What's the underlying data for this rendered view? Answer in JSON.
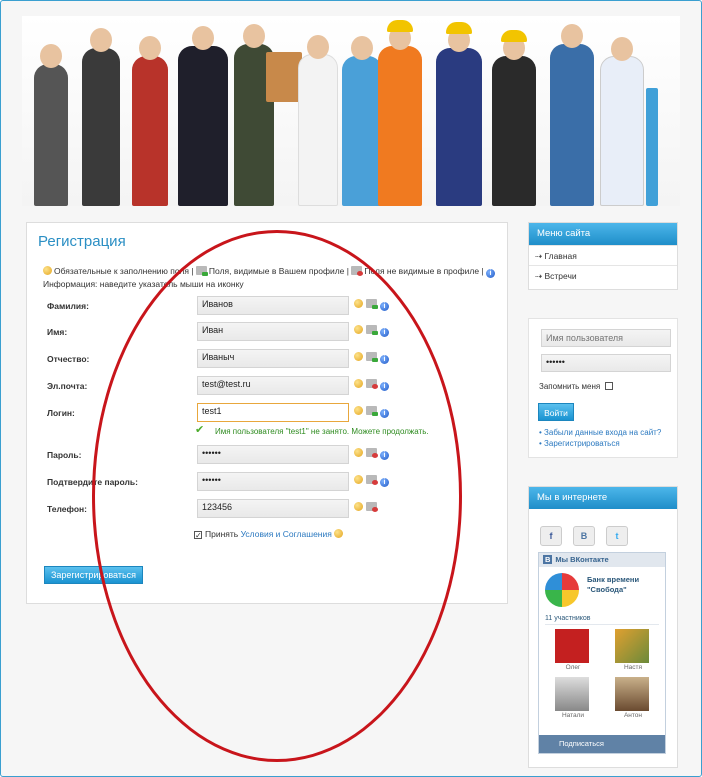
{
  "page": {
    "title": "Регистрация"
  },
  "legend": {
    "required": "Обязательные к заполнению поля |",
    "visible": "Поля, видимые в Вашем профиле |",
    "hidden": "Поля не видимые в профиле |",
    "info": "Информация: наведите указатель мыши на иконку"
  },
  "form": {
    "fields": [
      {
        "label": "Фамилия:",
        "value": "Иванов",
        "icons": [
          "required-icon",
          "visible-icon",
          "info-icon"
        ]
      },
      {
        "label": "Имя:",
        "value": "Иван",
        "icons": [
          "required-icon",
          "visible-icon",
          "info-icon"
        ]
      },
      {
        "label": "Отчество:",
        "value": "Иваныч",
        "icons": [
          "required-icon",
          "visible-icon",
          "info-icon"
        ]
      },
      {
        "label": "Эл.почта:",
        "value": "test@test.ru",
        "icons": [
          "required-icon",
          "hidden-icon",
          "info-icon"
        ]
      },
      {
        "label": "Логин:",
        "value": "test1",
        "icons": [
          "required-icon",
          "visible-icon",
          "info-icon"
        ]
      },
      {
        "label": "Пароль:",
        "value": "••••••",
        "icons": [
          "required-icon",
          "hidden-icon",
          "info-icon"
        ]
      },
      {
        "label": "Подтвердите пароль:",
        "value": "••••••",
        "icons": [
          "required-icon",
          "hidden-icon",
          "info-icon"
        ]
      },
      {
        "label": "Телефон:",
        "value": "123456",
        "icons": [
          "required-icon",
          "hidden-icon"
        ]
      }
    ],
    "login_ok": "Имя пользователя \"test1\" не занято. Можете продолжать.",
    "accept_prefix": "Принять",
    "accept_link": "Условия и Соглашения",
    "submit_label": "Зарегистрироваться"
  },
  "menu": {
    "title": "Меню сайта",
    "items": [
      "Главная",
      "Встречи"
    ]
  },
  "login": {
    "username_placeholder": "Имя пользователя",
    "password_value": "••••••",
    "remember_label": "Запомнить меня",
    "submit_label": "Войти",
    "forgot_link": "Забыли данные входа на сайт?",
    "register_link": "Зарегистрироваться"
  },
  "social": {
    "title": "Мы в интернете",
    "buttons": [
      "f",
      "B",
      "t"
    ],
    "vk": {
      "header": "Мы ВКонтакте",
      "group_name": "Банк времени \"Свобода\"",
      "members_count": "11 участников",
      "members": [
        "Олег",
        "Настя",
        "Натали",
        "Антон"
      ],
      "subscribe_label": "Подписаться"
    }
  },
  "colors": {
    "accent": "#2b8fc4",
    "annotation": "#c8151b",
    "button": "#1a93d1"
  }
}
